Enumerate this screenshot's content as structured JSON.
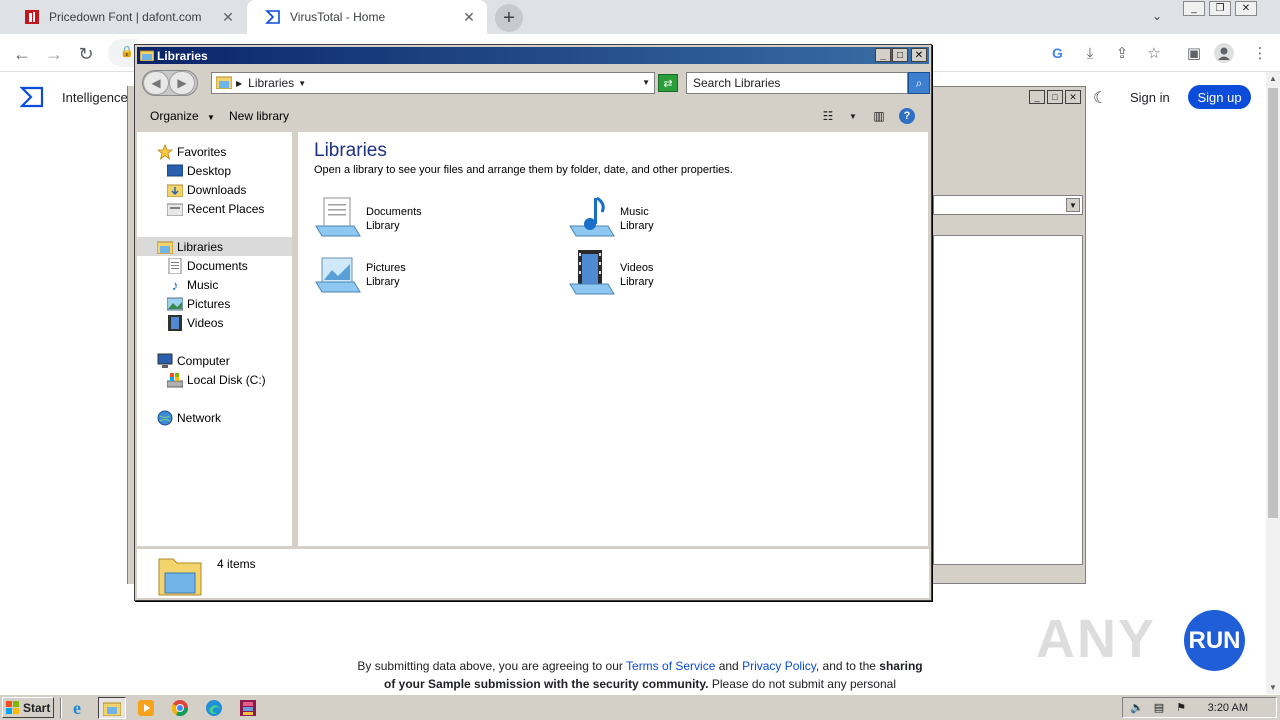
{
  "browser": {
    "tabs": [
      {
        "title": "Pricedown Font | dafont.com",
        "active": false
      },
      {
        "title": "VirusTotal - Home",
        "active": true
      }
    ],
    "new_tab_label": "+",
    "tab_search_glyph": "⌄"
  },
  "virustotal": {
    "intelligence_label": "Intelligence",
    "sign_in_label": "Sign in",
    "sign_up_label": "Sign up",
    "terms": {
      "prefix": "By submitting data above, you are agreeing to our ",
      "tos": "Terms of Service",
      "and": " and ",
      "privacy": "Privacy Policy",
      "mid": ", and to the ",
      "sharing": "sharing",
      "line2_bold": "of your Sample submission with the security community.",
      "line2_rest": " Please do not submit any personal"
    }
  },
  "explorer": {
    "window_title": "Libraries",
    "address": "Libraries",
    "search_placeholder": "Search Libraries",
    "commands": {
      "organize": "Organize",
      "new_library": "New library"
    },
    "nav": {
      "favorites": "Favorites",
      "desktop": "Desktop",
      "downloads": "Downloads",
      "recent_places": "Recent Places",
      "libraries": "Libraries",
      "documents": "Documents",
      "music": "Music",
      "pictures": "Pictures",
      "videos": "Videos",
      "computer": "Computer",
      "local_disk": "Local Disk (C:)",
      "network": "Network"
    },
    "content": {
      "title": "Libraries",
      "subtitle": "Open a library to see your files and arrange them by folder, date, and other properties.",
      "libraries": [
        {
          "name": "Documents",
          "type": "Library",
          "icon": "documents-library-icon"
        },
        {
          "name": "Music",
          "type": "Library",
          "icon": "music-library-icon"
        },
        {
          "name": "Pictures",
          "type": "Library",
          "icon": "pictures-library-icon"
        },
        {
          "name": "Videos",
          "type": "Library",
          "icon": "videos-library-icon"
        }
      ]
    },
    "status": "4 items"
  },
  "taskbar": {
    "start_label": "Start",
    "clock": "3:20 AM"
  },
  "watermark": {
    "text": "ANY",
    "badge": "RUN"
  },
  "colors": {
    "titlebar_start": "#0a246a",
    "titlebar_end": "#3a6ea5",
    "vt_blue": "#0b4dda",
    "content_title": "#1e3287",
    "classic_gray": "#d4d0c8"
  }
}
